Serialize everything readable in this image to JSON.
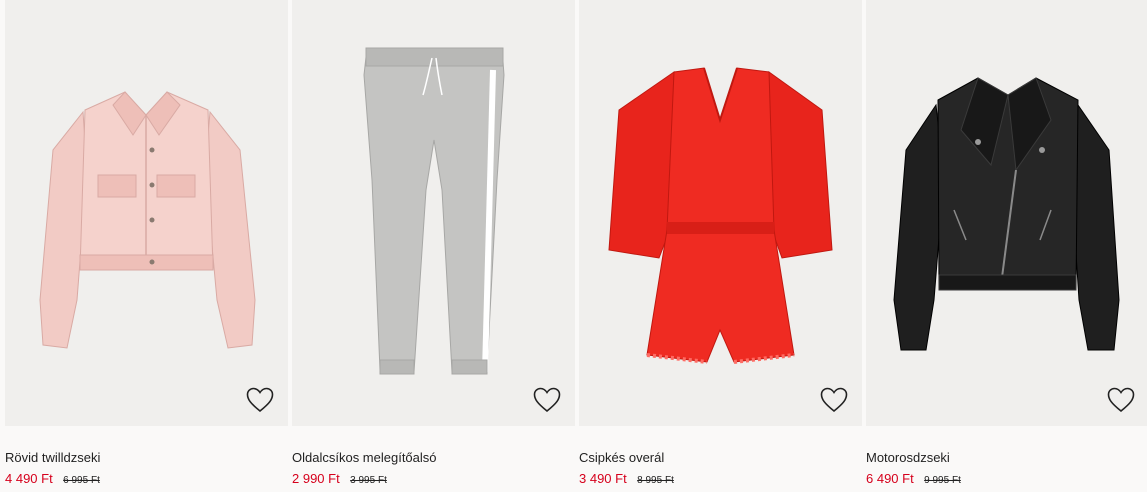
{
  "products": [
    {
      "name": "Rövid twilldzseki",
      "price": "4 490 Ft",
      "old_price": "6 995 Ft",
      "image_icon": "denim-jacket-icon",
      "color": "#f0c9c3"
    },
    {
      "name": "Oldalcsíkos melegítőalsó",
      "price": "2 990 Ft",
      "old_price": "3 995 Ft",
      "image_icon": "sweatpants-icon",
      "color": "#bdbdbb"
    },
    {
      "name": "Csipkés overál",
      "price": "3 490 Ft",
      "old_price": "8 995 Ft",
      "image_icon": "playsuit-icon",
      "color": "#e8241c"
    },
    {
      "name": "Motorosdzseki",
      "price": "6 490 Ft",
      "old_price": "9 995 Ft",
      "image_icon": "biker-jacket-icon",
      "color": "#1e1e1e"
    }
  ],
  "favorite_icon": "heart-icon",
  "colors": {
    "sale_price": "#d6001c",
    "image_bg": "#f0efed",
    "page_bg": "#faf9f8"
  }
}
